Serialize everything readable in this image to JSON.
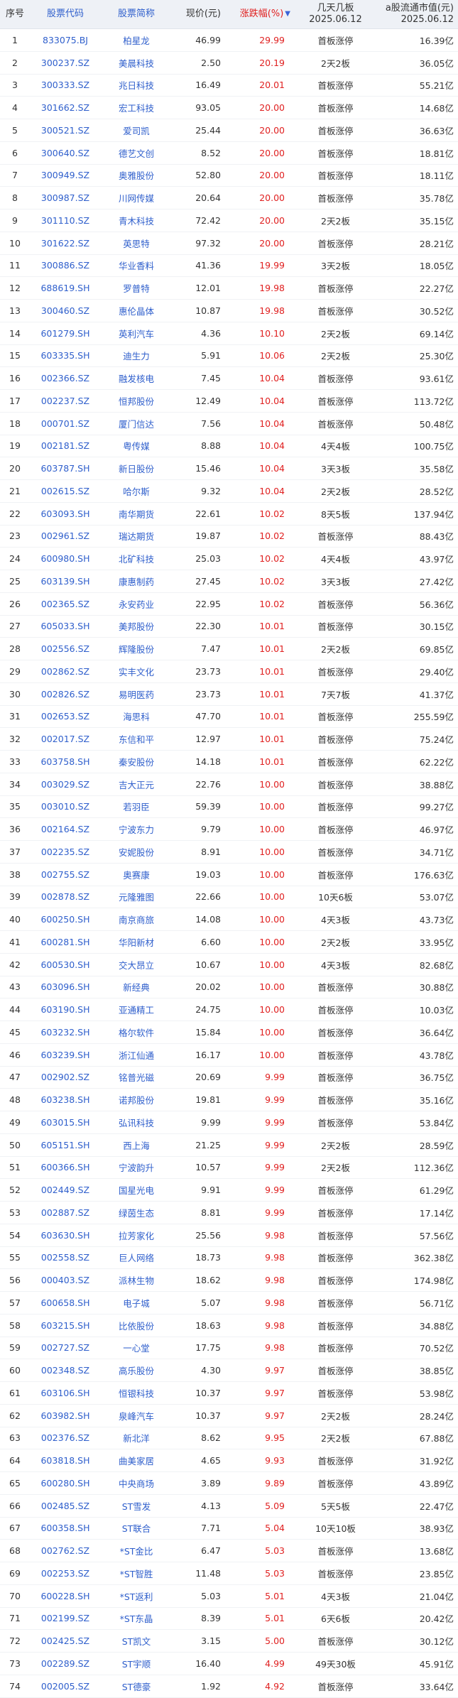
{
  "header": {
    "idx": "序号",
    "code": "股票代码",
    "name": "股票简称",
    "price": "现价(元)",
    "pct": "涨跌幅(%)",
    "sort_glyph": "▼",
    "board_line1": "几天几板",
    "board_line2": "2025.06.12",
    "cap_line1": "a股流通市值(元)",
    "cap_line2": "2025.06.12"
  },
  "colors": {
    "link": "#2f5fcc",
    "up": "#e02020",
    "header_bg": "#eef1f6"
  },
  "rows": [
    [
      "1",
      "833075.BJ",
      "柏星龙",
      "46.99",
      "29.99",
      "首板涨停",
      "16.39亿"
    ],
    [
      "2",
      "300237.SZ",
      "美晨科技",
      "2.50",
      "20.19",
      "2天2板",
      "36.05亿"
    ],
    [
      "3",
      "300333.SZ",
      "兆日科技",
      "16.49",
      "20.01",
      "首板涨停",
      "55.21亿"
    ],
    [
      "4",
      "301662.SZ",
      "宏工科技",
      "93.05",
      "20.00",
      "首板涨停",
      "14.68亿"
    ],
    [
      "5",
      "300521.SZ",
      "爱司凯",
      "25.44",
      "20.00",
      "首板涨停",
      "36.63亿"
    ],
    [
      "6",
      "300640.SZ",
      "德艺文创",
      "8.52",
      "20.00",
      "首板涨停",
      "18.81亿"
    ],
    [
      "7",
      "300949.SZ",
      "奥雅股份",
      "52.80",
      "20.00",
      "首板涨停",
      "18.11亿"
    ],
    [
      "8",
      "300987.SZ",
      "川网传媒",
      "20.64",
      "20.00",
      "首板涨停",
      "35.78亿"
    ],
    [
      "9",
      "301110.SZ",
      "青木科技",
      "72.42",
      "20.00",
      "2天2板",
      "35.15亿"
    ],
    [
      "10",
      "301622.SZ",
      "英思特",
      "97.32",
      "20.00",
      "首板涨停",
      "28.21亿"
    ],
    [
      "11",
      "300886.SZ",
      "华业香料",
      "41.36",
      "19.99",
      "3天2板",
      "18.05亿"
    ],
    [
      "12",
      "688619.SH",
      "罗普特",
      "12.01",
      "19.98",
      "首板涨停",
      "22.27亿"
    ],
    [
      "13",
      "300460.SZ",
      "惠伦晶体",
      "10.87",
      "19.98",
      "首板涨停",
      "30.52亿"
    ],
    [
      "14",
      "601279.SH",
      "英利汽车",
      "4.36",
      "10.10",
      "2天2板",
      "69.14亿"
    ],
    [
      "15",
      "603335.SH",
      "迪生力",
      "5.91",
      "10.06",
      "2天2板",
      "25.30亿"
    ],
    [
      "16",
      "002366.SZ",
      "融发核电",
      "7.45",
      "10.04",
      "首板涨停",
      "93.61亿"
    ],
    [
      "17",
      "002237.SZ",
      "恒邦股份",
      "12.49",
      "10.04",
      "首板涨停",
      "113.72亿"
    ],
    [
      "18",
      "000701.SZ",
      "厦门信达",
      "7.56",
      "10.04",
      "首板涨停",
      "50.48亿"
    ],
    [
      "19",
      "002181.SZ",
      "粤传媒",
      "8.88",
      "10.04",
      "4天4板",
      "100.75亿"
    ],
    [
      "20",
      "603787.SH",
      "新日股份",
      "15.46",
      "10.04",
      "3天3板",
      "35.58亿"
    ],
    [
      "21",
      "002615.SZ",
      "哈尔斯",
      "9.32",
      "10.04",
      "2天2板",
      "28.52亿"
    ],
    [
      "22",
      "603093.SH",
      "南华期货",
      "22.61",
      "10.02",
      "8天5板",
      "137.94亿"
    ],
    [
      "23",
      "002961.SZ",
      "瑞达期货",
      "19.87",
      "10.02",
      "首板涨停",
      "88.43亿"
    ],
    [
      "24",
      "600980.SH",
      "北矿科技",
      "25.03",
      "10.02",
      "4天4板",
      "43.97亿"
    ],
    [
      "25",
      "603139.SH",
      "康惠制药",
      "27.45",
      "10.02",
      "3天3板",
      "27.42亿"
    ],
    [
      "26",
      "002365.SZ",
      "永安药业",
      "22.95",
      "10.02",
      "首板涨停",
      "56.36亿"
    ],
    [
      "27",
      "605033.SH",
      "美邦股份",
      "22.30",
      "10.01",
      "首板涨停",
      "30.15亿"
    ],
    [
      "28",
      "002556.SZ",
      "辉隆股份",
      "7.47",
      "10.01",
      "2天2板",
      "69.85亿"
    ],
    [
      "29",
      "002862.SZ",
      "实丰文化",
      "23.73",
      "10.01",
      "首板涨停",
      "29.40亿"
    ],
    [
      "30",
      "002826.SZ",
      "易明医药",
      "23.73",
      "10.01",
      "7天7板",
      "41.37亿"
    ],
    [
      "31",
      "002653.SZ",
      "海思科",
      "47.70",
      "10.01",
      "首板涨停",
      "255.59亿"
    ],
    [
      "32",
      "002017.SZ",
      "东信和平",
      "12.97",
      "10.01",
      "首板涨停",
      "75.24亿"
    ],
    [
      "33",
      "603758.SH",
      "秦安股份",
      "14.18",
      "10.01",
      "首板涨停",
      "62.22亿"
    ],
    [
      "34",
      "003029.SZ",
      "吉大正元",
      "22.76",
      "10.00",
      "首板涨停",
      "38.88亿"
    ],
    [
      "35",
      "003010.SZ",
      "若羽臣",
      "59.39",
      "10.00",
      "首板涨停",
      "99.27亿"
    ],
    [
      "36",
      "002164.SZ",
      "宁波东力",
      "9.79",
      "10.00",
      "首板涨停",
      "46.97亿"
    ],
    [
      "37",
      "002235.SZ",
      "安妮股份",
      "8.91",
      "10.00",
      "首板涨停",
      "34.71亿"
    ],
    [
      "38",
      "002755.SZ",
      "奥赛康",
      "19.03",
      "10.00",
      "首板涨停",
      "176.63亿"
    ],
    [
      "39",
      "002878.SZ",
      "元隆雅图",
      "22.66",
      "10.00",
      "10天6板",
      "53.07亿"
    ],
    [
      "40",
      "600250.SH",
      "南京商旅",
      "14.08",
      "10.00",
      "4天3板",
      "43.73亿"
    ],
    [
      "41",
      "600281.SH",
      "华阳新材",
      "6.60",
      "10.00",
      "2天2板",
      "33.95亿"
    ],
    [
      "42",
      "600530.SH",
      "交大昂立",
      "10.67",
      "10.00",
      "4天3板",
      "82.68亿"
    ],
    [
      "43",
      "603096.SH",
      "新经典",
      "20.02",
      "10.00",
      "首板涨停",
      "30.88亿"
    ],
    [
      "44",
      "603190.SH",
      "亚通精工",
      "24.75",
      "10.00",
      "首板涨停",
      "10.03亿"
    ],
    [
      "45",
      "603232.SH",
      "格尔软件",
      "15.84",
      "10.00",
      "首板涨停",
      "36.64亿"
    ],
    [
      "46",
      "603239.SH",
      "浙江仙通",
      "16.17",
      "10.00",
      "首板涨停",
      "43.78亿"
    ],
    [
      "47",
      "002902.SZ",
      "铭普光磁",
      "20.69",
      "9.99",
      "首板涨停",
      "36.75亿"
    ],
    [
      "48",
      "603238.SH",
      "诺邦股份",
      "19.81",
      "9.99",
      "首板涨停",
      "35.16亿"
    ],
    [
      "49",
      "603015.SH",
      "弘讯科技",
      "9.99",
      "9.99",
      "首板涨停",
      "53.84亿"
    ],
    [
      "50",
      "605151.SH",
      "西上海",
      "21.25",
      "9.99",
      "2天2板",
      "28.59亿"
    ],
    [
      "51",
      "600366.SH",
      "宁波韵升",
      "10.57",
      "9.99",
      "2天2板",
      "112.36亿"
    ],
    [
      "52",
      "002449.SZ",
      "国星光电",
      "9.91",
      "9.99",
      "首板涨停",
      "61.29亿"
    ],
    [
      "53",
      "002887.SZ",
      "绿茵生态",
      "8.81",
      "9.99",
      "首板涨停",
      "17.14亿"
    ],
    [
      "54",
      "603630.SH",
      "拉芳家化",
      "25.56",
      "9.98",
      "首板涨停",
      "57.56亿"
    ],
    [
      "55",
      "002558.SZ",
      "巨人网络",
      "18.73",
      "9.98",
      "首板涨停",
      "362.38亿"
    ],
    [
      "56",
      "000403.SZ",
      "派林生物",
      "18.62",
      "9.98",
      "首板涨停",
      "174.98亿"
    ],
    [
      "57",
      "600658.SH",
      "电子城",
      "5.07",
      "9.98",
      "首板涨停",
      "56.71亿"
    ],
    [
      "58",
      "603215.SH",
      "比依股份",
      "18.63",
      "9.98",
      "首板涨停",
      "34.88亿"
    ],
    [
      "59",
      "002727.SZ",
      "一心堂",
      "17.75",
      "9.98",
      "首板涨停",
      "70.52亿"
    ],
    [
      "60",
      "002348.SZ",
      "高乐股份",
      "4.30",
      "9.97",
      "首板涨停",
      "38.85亿"
    ],
    [
      "61",
      "603106.SH",
      "恒银科技",
      "10.37",
      "9.97",
      "首板涨停",
      "53.98亿"
    ],
    [
      "62",
      "603982.SH",
      "泉峰汽车",
      "10.37",
      "9.97",
      "2天2板",
      "28.24亿"
    ],
    [
      "63",
      "002376.SZ",
      "新北洋",
      "8.62",
      "9.95",
      "2天2板",
      "67.88亿"
    ],
    [
      "64",
      "603818.SH",
      "曲美家居",
      "4.65",
      "9.93",
      "首板涨停",
      "31.92亿"
    ],
    [
      "65",
      "600280.SH",
      "中央商场",
      "3.89",
      "9.89",
      "首板涨停",
      "43.89亿"
    ],
    [
      "66",
      "002485.SZ",
      "ST雪发",
      "4.13",
      "5.09",
      "5天5板",
      "22.47亿"
    ],
    [
      "67",
      "600358.SH",
      "ST联合",
      "7.71",
      "5.04",
      "10天10板",
      "38.93亿"
    ],
    [
      "68",
      "002762.SZ",
      "*ST金比",
      "6.47",
      "5.03",
      "首板涨停",
      "13.68亿"
    ],
    [
      "69",
      "002253.SZ",
      "*ST智胜",
      "11.48",
      "5.03",
      "首板涨停",
      "23.85亿"
    ],
    [
      "70",
      "600228.SH",
      "*ST返利",
      "5.03",
      "5.01",
      "4天3板",
      "21.04亿"
    ],
    [
      "71",
      "002199.SZ",
      "*ST东晶",
      "8.39",
      "5.01",
      "6天6板",
      "20.42亿"
    ],
    [
      "72",
      "002425.SZ",
      "ST凯文",
      "3.15",
      "5.00",
      "首板涨停",
      "30.12亿"
    ],
    [
      "73",
      "002289.SZ",
      "ST宇顺",
      "16.40",
      "4.99",
      "49天30板",
      "45.91亿"
    ],
    [
      "74",
      "002005.SZ",
      "ST德豪",
      "1.92",
      "4.92",
      "首板涨停",
      "33.64亿"
    ]
  ]
}
